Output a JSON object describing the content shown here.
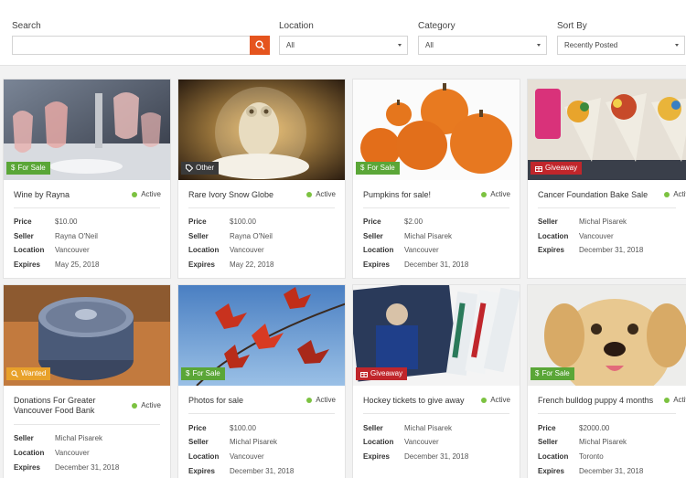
{
  "filters": {
    "search_label": "Search",
    "search_value": "",
    "location_label": "Location",
    "location_value": "All",
    "category_label": "Category",
    "category_value": "All",
    "sort_label": "Sort By",
    "sort_value": "Recently Posted"
  },
  "field_labels": {
    "price": "Price",
    "seller": "Seller",
    "location": "Location",
    "expires": "Expires"
  },
  "listings": [
    {
      "title": "Wine by Rayna",
      "tag": "For Sale",
      "tag_icon": "dollar-icon",
      "status": "Active",
      "price": "$10.00",
      "seller": "Rayna O'Neil",
      "location": "Vancouver",
      "expires": "May 25, 2018"
    },
    {
      "title": "Rare Ivory Snow Globe",
      "tag": "Other",
      "tag_icon": "tag-icon",
      "status": "Active",
      "price": "$100.00",
      "seller": "Rayna O'Neil",
      "location": "Vancouver",
      "expires": "May 22, 2018"
    },
    {
      "title": "Pumpkins for sale!",
      "tag": "For Sale",
      "tag_icon": "dollar-icon",
      "status": "Active",
      "price": "$2.00",
      "seller": "Michal Pisarek",
      "location": "Vancouver",
      "expires": "December 31, 2018"
    },
    {
      "title": "Cancer Foundation Bake Sale",
      "tag": "Giveaway",
      "tag_icon": "gift-icon",
      "status": "Active",
      "seller": "Michal Pisarek",
      "location": "Vancouver",
      "expires": "December 31, 2018"
    },
    {
      "title": "Donations For Greater Vancouver Food Bank",
      "tag": "Wanted",
      "tag_icon": "search-icon",
      "status": "Active",
      "seller": "Michal Pisarek",
      "location": "Vancouver",
      "expires": "December 31, 2018"
    },
    {
      "title": "Photos for sale",
      "tag": "For Sale",
      "tag_icon": "dollar-icon",
      "status": "Active",
      "price": "$100.00",
      "seller": "Michal Pisarek",
      "location": "Vancouver",
      "expires": "December 31, 2018"
    },
    {
      "title": "Hockey tickets to give away",
      "tag": "Giveaway",
      "tag_icon": "gift-icon",
      "status": "Active",
      "seller": "Michal Pisarek",
      "location": "Vancouver",
      "expires": "December 31, 2018"
    },
    {
      "title": "French bulldog puppy 4 months",
      "tag": "For Sale",
      "tag_icon": "dollar-icon",
      "status": "Active",
      "price": "$2000.00",
      "seller": "Michal Pisarek",
      "location": "Toronto",
      "expires": "December 31, 2018"
    }
  ],
  "colors": {
    "accent": "#e5541e",
    "for_sale": "#5aa637",
    "giveaway": "#c0262b",
    "wanted": "#e8a12a",
    "other": "#3a3a3a",
    "active_dot": "#7cc241"
  }
}
